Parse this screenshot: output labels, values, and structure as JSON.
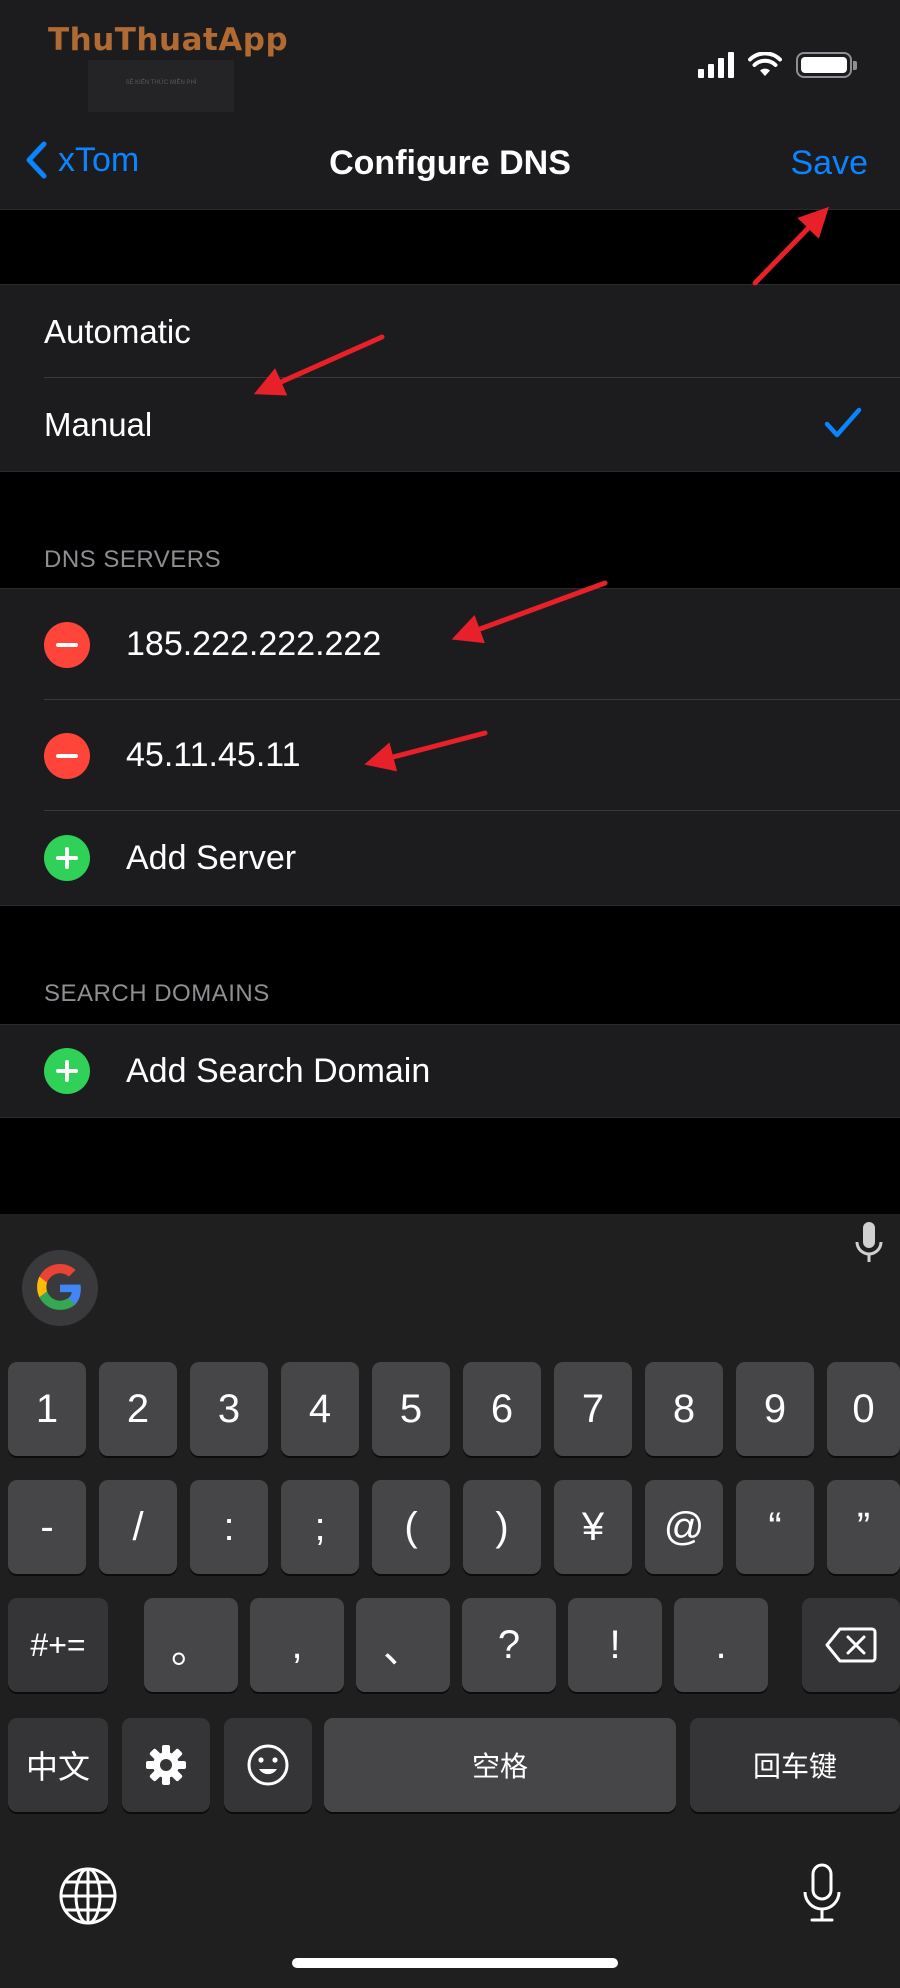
{
  "watermark": {
    "brand": "ThuThuatApp",
    "tagline": "SẺ KIẾN THỨC MIỄN PHÍ"
  },
  "status_bar": {
    "signal_icon": "cellular-signal-icon",
    "wifi_icon": "wifi-icon",
    "battery_icon": "battery-icon"
  },
  "nav": {
    "back_label": "xTom",
    "title": "Configure DNS",
    "save_label": "Save"
  },
  "mode": {
    "options": [
      {
        "label": "Automatic",
        "selected": false
      },
      {
        "label": "Manual",
        "selected": true
      }
    ]
  },
  "dns_servers": {
    "header": "DNS SERVERS",
    "entries": [
      "185.222.222.222",
      "45.11.45.11"
    ],
    "add_label": "Add Server"
  },
  "search_domains": {
    "header": "SEARCH DOMAINS",
    "add_label": "Add Search Domain"
  },
  "keyboard": {
    "row1": [
      "1",
      "2",
      "3",
      "4",
      "5",
      "6",
      "7",
      "8",
      "9",
      "0"
    ],
    "row2": [
      "-",
      "/",
      ":",
      ";",
      "(",
      ")",
      "¥",
      "@",
      "“",
      "”"
    ],
    "row3": [
      "。",
      ",",
      "、",
      "?",
      "!",
      "."
    ],
    "toggle_symbols": "#+=",
    "toggle_lang": "中文",
    "space": "空格",
    "return": "回车键"
  },
  "colors": {
    "accent": "#0a84ff",
    "remove": "#ff453a",
    "add": "#30d158",
    "annotation": "#e8202a"
  }
}
